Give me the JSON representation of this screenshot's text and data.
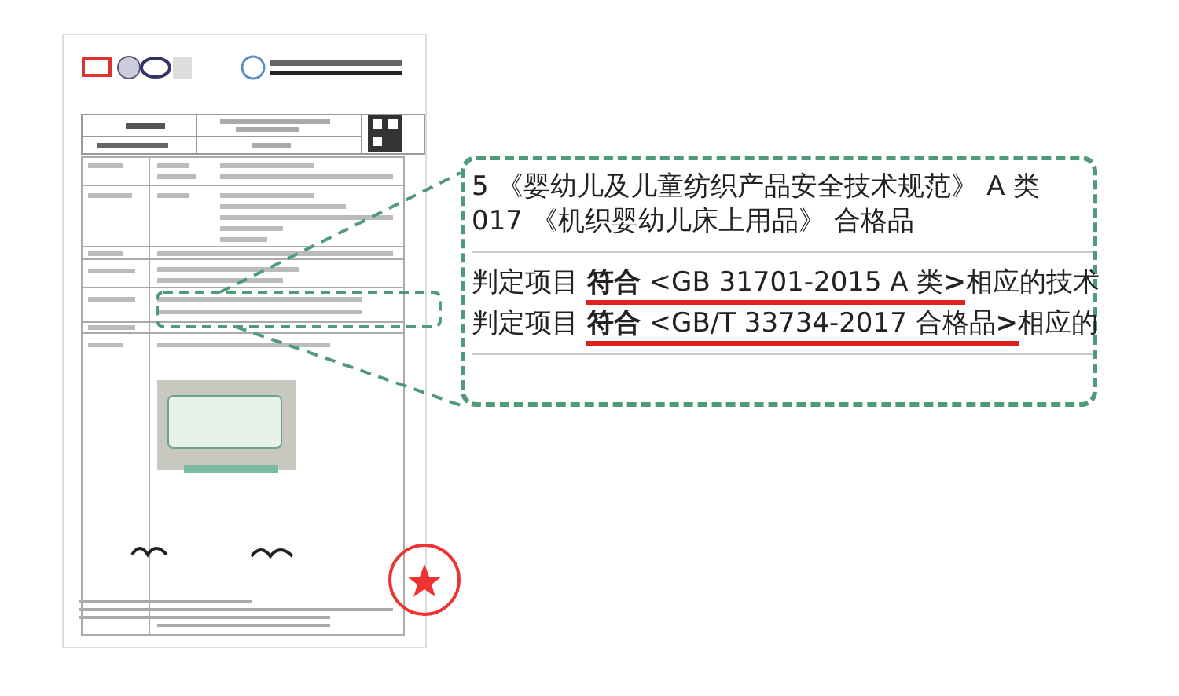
{
  "magnifier": {
    "standards": [
      "5 《婴幼儿及儿童纺织产品安全技术规范》 A 类",
      "017 《机织婴幼儿床上用品》 合格品"
    ],
    "conclusions": [
      {
        "prefix": "判定项目",
        "result": "**符合**  <GB 31701-2015 A 类**>**",
        "suffix": "相应的技术"
      },
      {
        "prefix": "判定项目",
        "result": "**符合**  <GB/T 33734-2017  合格品**>**",
        "suffix": "相应的"
      }
    ]
  }
}
